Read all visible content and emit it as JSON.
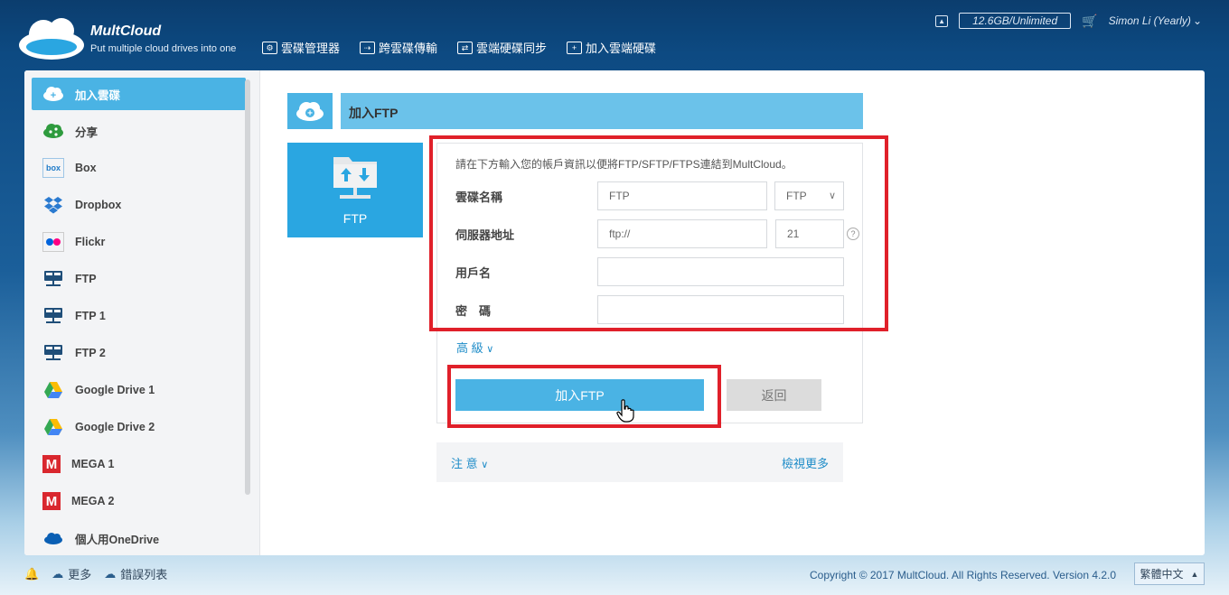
{
  "brand": {
    "name": "MultCloud",
    "tagline": "Put multiple cloud drives into one"
  },
  "nav": [
    {
      "label": "雲碟管理器",
      "icon": "cloud-manager-icon"
    },
    {
      "label": "跨雲碟傳輸",
      "icon": "transfer-icon"
    },
    {
      "label": "雲端硬碟同步",
      "icon": "sync-icon"
    },
    {
      "label": "加入雲端硬碟",
      "icon": "add-cloud-icon"
    }
  ],
  "account": {
    "quota": "12.6GB/Unlimited",
    "user": "Simon Li (Yearly)"
  },
  "sidebar": {
    "items": [
      {
        "label": "加入雲碟",
        "icon": "add-cloud-icon",
        "active": true
      },
      {
        "label": "分享",
        "icon": "share-icon"
      },
      {
        "label": "Box",
        "icon": "box-icon"
      },
      {
        "label": "Dropbox",
        "icon": "dropbox-icon"
      },
      {
        "label": "Flickr",
        "icon": "flickr-icon"
      },
      {
        "label": "FTP",
        "icon": "ftp-icon"
      },
      {
        "label": "FTP 1",
        "icon": "ftp-icon"
      },
      {
        "label": "FTP 2",
        "icon": "ftp-icon"
      },
      {
        "label": "Google Drive 1",
        "icon": "google-drive-icon"
      },
      {
        "label": "Google Drive 2",
        "icon": "google-drive-icon"
      },
      {
        "label": "MEGA 1",
        "icon": "mega-icon"
      },
      {
        "label": "MEGA 2",
        "icon": "mega-icon"
      },
      {
        "label": "個人用OneDrive",
        "icon": "onedrive-icon"
      }
    ]
  },
  "main": {
    "title": "加入FTP",
    "tile_label": "FTP",
    "form": {
      "description": "請在下方輸入您的帳戶資訊以便將FTP/SFTP/FTPS連結到MultCloud。",
      "drive_name_label": "雲碟名稱",
      "drive_name_value": "FTP",
      "protocol_value": "FTP",
      "server_label": "伺服器地址",
      "server_placeholder": "ftp://",
      "port_value": "21",
      "username_label": "用戶名",
      "password_label": "密　碼",
      "advanced_label": "高 級",
      "add_button": "加入FTP",
      "back_button": "返回"
    },
    "notes": {
      "label": "注 意",
      "more": "檢視更多"
    }
  },
  "footer": {
    "more": "更多",
    "errors": "錯誤列表",
    "copyright": "Copyright © 2017 MultCloud. All Rights Reserved. Version 4.2.0",
    "language": "繁體中文"
  },
  "colors": {
    "accent": "#4ab3e4",
    "highlight": "#e0202a"
  }
}
